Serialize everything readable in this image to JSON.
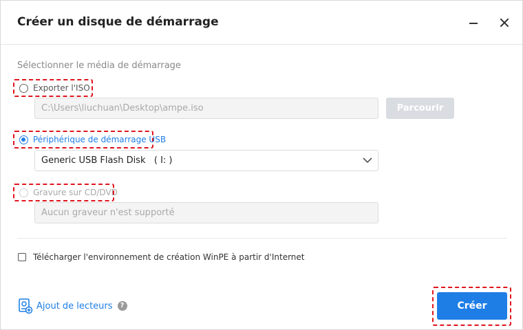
{
  "window": {
    "title": "Créer un disque de démarrage"
  },
  "boot_media": {
    "section_label": "Sélectionner le média de démarrage",
    "options": [
      {
        "label": "Exporter l'ISO",
        "selected": false,
        "enabled": true
      },
      {
        "label": "Périphérique de démarrage USB",
        "selected": true,
        "enabled": true
      },
      {
        "label": "Gravure sur CD/DVD",
        "selected": false,
        "enabled": false
      }
    ],
    "iso_path": "C:\\Users\\liuchuan\\Desktop\\ampe.iso",
    "browse_label": "Parcourir",
    "usb_selected": "Generic USB Flash Disk   ( I: )",
    "cd_placeholder": "Aucun graveur n'est supporté"
  },
  "download_winpe": {
    "label": "Télécharger l'environnement de création WinPE à partir d'Internet",
    "checked": false
  },
  "footer": {
    "add_drivers_label": "Ajout de lecteurs",
    "help_glyph": "?",
    "create_label": "Créer"
  },
  "colors": {
    "accent": "#1e7ee6",
    "highlight_border": "#e0131c",
    "disabled_button": "#d9dce1"
  },
  "icons": {
    "minimize": "minimize-icon",
    "close": "close-icon",
    "dropdown": "chevron-down-icon",
    "add_drivers": "add-drivers-icon",
    "help": "help-icon"
  }
}
